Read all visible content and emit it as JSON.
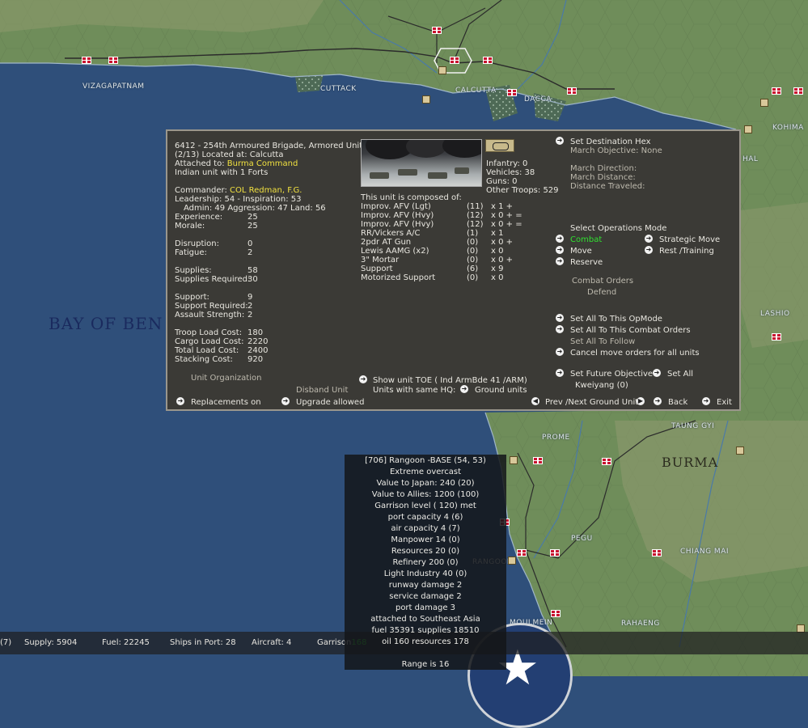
{
  "map": {
    "labels": [
      "VIZAGAPATNAM",
      "CUTTACK",
      "CALCUTTA",
      "DACCA",
      "KOHIMA",
      "HAL",
      "LASHIO",
      "BAY OF BEN",
      "PROME",
      "TAUNG GYI",
      "BURMA",
      "PEGU",
      "CHIANG MAI",
      "RANGOON",
      "MOULMEIN",
      "RAHAENG"
    ],
    "colors": {
      "ocean": "#2f4f7a",
      "land": "#6f8d5a",
      "highland": "#8e9a6e",
      "accent": "#c8102e"
    }
  },
  "unit_panel": {
    "header_line1": "6412 - 254th Armoured Brigade, Armored Unit",
    "header_line2": "(2/13) Located at: Calcutta",
    "attached_label": "Attached to:",
    "attached_value": "Burma Command",
    "origin_line": "Indian unit with 1 Forts",
    "commander_label": "Commander:",
    "commander_value": "COL Redman, F.G.",
    "leadership_line": "Leadership: 54 - Inspiration: 53",
    "admin_line": "Admin: 49  Aggression: 47  Land: 56",
    "stats_a": [
      {
        "label": "Experience:",
        "value": "25"
      },
      {
        "label": "Morale:",
        "value": "25"
      }
    ],
    "stats_b": [
      {
        "label": "Disruption:",
        "value": "0"
      },
      {
        "label": "Fatigue:",
        "value": "2"
      }
    ],
    "stats_c": [
      {
        "label": "Supplies:",
        "value": "58"
      },
      {
        "label": "Supplies Required:",
        "value": "30"
      }
    ],
    "stats_d": [
      {
        "label": "Support:",
        "value": "9"
      },
      {
        "label": "Support Required:",
        "value": "2"
      },
      {
        "label": "Assault Strength:",
        "value": "2"
      }
    ],
    "stats_e": [
      {
        "label": "Troop Load Cost:",
        "value": "180"
      },
      {
        "label": "Cargo Load Cost:",
        "value": "2220"
      },
      {
        "label": "Total Load Cost:",
        "value": "2400"
      },
      {
        "label": "Stacking Cost:",
        "value": "920"
      }
    ],
    "unit_organization": "Unit Organization",
    "disband_unit": "Disband Unit",
    "replacements_label": "Replacements on",
    "upgrade_label": "Upgrade allowed",
    "counts": {
      "infantry": "Infantry: 0",
      "vehicles": "Vehicles: 38",
      "guns": "Guns: 0",
      "other": "Other Troops: 529"
    },
    "composed_title": "This unit is composed of:",
    "composition": [
      {
        "name": "Improv. AFV (Lgt)",
        "count": "(11)",
        "mult": "x 1 +"
      },
      {
        "name": "Improv. AFV (Hvy)",
        "count": "(12)",
        "mult": "x 0 + ="
      },
      {
        "name": "Improv. AFV (Hvy)",
        "count": "(12)",
        "mult": "x 0 + ="
      },
      {
        "name": "RR/Vickers A/C",
        "count": "(1)",
        "mult": "x 1"
      },
      {
        "name": "2pdr AT Gun",
        "count": "(0)",
        "mult": "x 0 +"
      },
      {
        "name": "Lewis AAMG (x2)",
        "count": "(0)",
        "mult": "x 0"
      },
      {
        "name": "3\" Mortar",
        "count": "(0)",
        "mult": "x 0 +"
      },
      {
        "name": "Support",
        "count": "(6)",
        "mult": "x 9"
      },
      {
        "name": "Motorized Support",
        "count": "(0)",
        "mult": "x 0"
      }
    ],
    "show_toe": "Show unit TOE ( Ind ArmBde 41 /ARM)",
    "units_same_hq": "Units with same HQ:",
    "ground_units": "Ground units",
    "destination": "Set Destination Hex",
    "march_objective": "March Objective: None",
    "march_direction": "March Direction:",
    "march_distance": "March Distance:",
    "distance_traveled": "Distance Traveled:",
    "ops_title": "Select Operations Mode",
    "ops": {
      "combat": "Combat",
      "move": "Move",
      "reserve": "Reserve",
      "strategic": "Strategic Move",
      "rest": "Rest /Training"
    },
    "combat_orders_title": "Combat Orders",
    "combat_orders_value": "Defend",
    "set_all_opmode": "Set All To This OpMode",
    "set_all_combat": "Set All To This Combat Orders",
    "set_all_follow": "Set All To Follow",
    "cancel_move": "Cancel move orders for all units",
    "future_objective": "Set Future Objective",
    "set_all": "Set All",
    "future_value": "Kweiyang (0)",
    "prev_next": "Prev /Next Ground Unit",
    "back": "Back",
    "exit": "Exit"
  },
  "base_panel": {
    "lines": [
      "[706] Rangoon -BASE (54, 53)",
      "Extreme overcast",
      "Value to Japan: 240 (20)",
      "Value to Allies: 1200 (100)",
      "Garrison level ( 120) met",
      "port capacity 4 (6)",
      "air capacity 4 (7)",
      "Manpower  14 (0)",
      "Resources  20 (0)",
      "Refinery  200 (0)",
      "Light Industry  40 (0)",
      "runway damage 2",
      "service damage 2",
      "port damage 3",
      "attached to Southeast Asia",
      "fuel 35391  supplies 18510",
      "oil 160  resources 178",
      "",
      "Range is 16"
    ]
  },
  "status_bar": {
    "prefix": "(7)",
    "supply": "Supply: 5904",
    "fuel": "Fuel: 22245",
    "ships": "Ships in Port: 28",
    "aircraft": "Aircraft: 4",
    "garrison_label": "Garrison",
    "garrison_value": "168"
  }
}
